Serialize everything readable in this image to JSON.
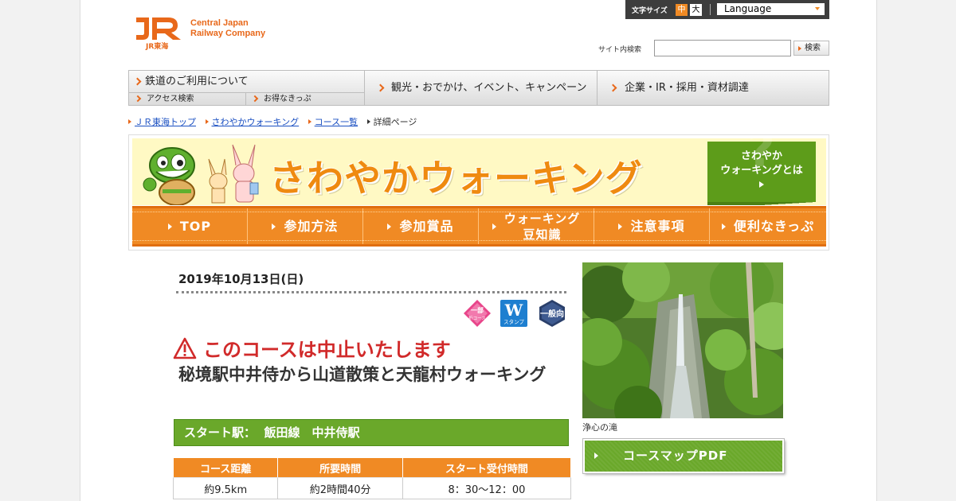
{
  "header": {
    "logo_mark": "JR",
    "logo_subtitle": "JR東海",
    "company_line1": "Central Japan",
    "company_line2": "Railway Company",
    "font_size_label": "文字サイズ",
    "font_size_options": [
      "中",
      "大"
    ],
    "language_label": "Language",
    "search_label": "サイト内検索",
    "search_placeholder": "",
    "search_button": "検索"
  },
  "global_nav": {
    "rail": "鉄道のご利用について",
    "access": "アクセス検索",
    "tickets": "お得なきっぷ",
    "travel": "観光・おでかけ、イベント、キャンペーン",
    "corporate": "企業・IR・採用・資材調達"
  },
  "breadcrumb": [
    "ＪＲ東海トップ",
    "さわやかウォーキング",
    "コース一覧",
    "詳細ページ"
  ],
  "banner": {
    "title": "さわやかウォーキング",
    "what_is_line1": "さわやか",
    "what_is_line2": "ウォーキングとは",
    "nav": [
      {
        "label": "TOP"
      },
      {
        "label": "参加方法"
      },
      {
        "label": "参加賞品"
      },
      {
        "label": "ウォーキング\n豆知識"
      },
      {
        "label": "注意事項"
      },
      {
        "label": "便利なきっぷ"
      }
    ]
  },
  "course": {
    "date": "2019年10月13日(日)",
    "badges": [
      "一部\n折コース",
      "W\nスタンプ",
      "一般向"
    ],
    "cancel_notice": "このコースは中止いたします",
    "title": "秘境駅中井侍から山道散策と天龍村ウォーキング",
    "start_station": "スタート駅：  飯田線　中井侍駅",
    "table_headers": [
      "コース距離",
      "所要時間",
      "スタート受付時間"
    ],
    "table_values": [
      "約9.5km",
      "約2時間40分",
      "8：30～12：00"
    ],
    "photo_caption": "浄心の滝",
    "map_button": "コースマップPDF"
  },
  "colors": {
    "accent_orange": "#f08a24",
    "brand_green": "#6aa82a",
    "warning_red": "#d12a2a"
  }
}
